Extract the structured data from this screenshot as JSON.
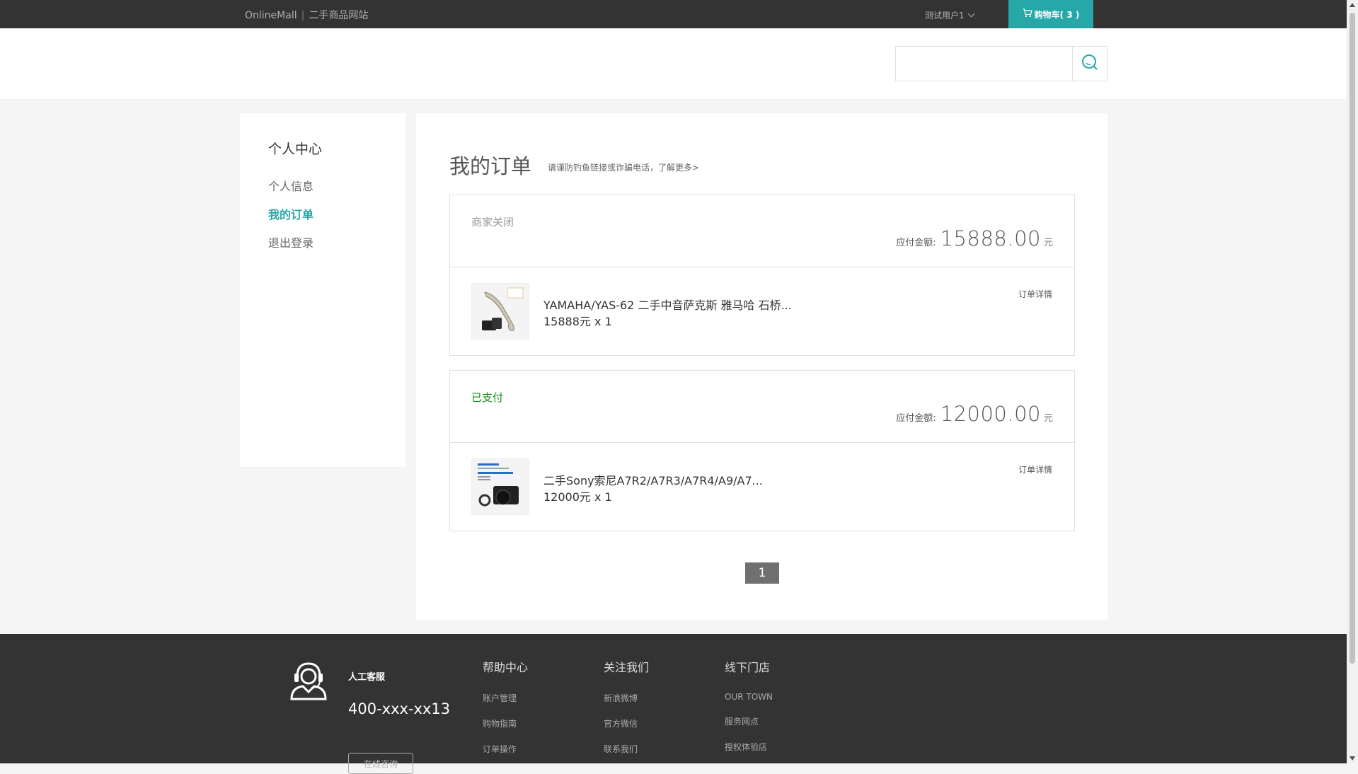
{
  "topbar": {
    "brand_name": "OnlineMall",
    "brand_separator": "|",
    "brand_subtitle": "二手商品网站",
    "username": "测试用户1",
    "cart_label": "购物车( 3 )",
    "cart_color": "#27a8a8"
  },
  "search": {
    "value": "",
    "button_icon": "search-icon"
  },
  "sidebar": {
    "title": "个人中心",
    "items": [
      {
        "label": "个人信息",
        "active": false
      },
      {
        "label": "我的订单",
        "active": true
      },
      {
        "label": "退出登录",
        "active": false
      }
    ]
  },
  "main": {
    "title": "我的订单",
    "tip": "请谨防钓鱼链接或诈骗电话，了解更多>",
    "amount_label": "应付金额:",
    "currency_unit": "元",
    "detail_label": "订单详情",
    "orders": [
      {
        "status": "商家关闭",
        "status_color": "#999999",
        "amount": "15888.00",
        "product_name": "YAMAHA/YAS-62 二手中音萨克斯 雅马哈 石桥...",
        "product_price": "15888元 x 1"
      },
      {
        "status": "已支付",
        "status_color": "#1a8f1a",
        "amount": "12000.00",
        "product_name": "二手Sony索尼A7R2/A7R3/A7R4/A9/A7...",
        "product_price": "12000元 x 1"
      }
    ],
    "pagination": {
      "current": "1"
    }
  },
  "footer": {
    "hotline_icon": "customer-service-headset-icon",
    "hotline_label": "人工客服",
    "hotline_number": "400-xxx-xx13",
    "consult_button": "在线咨询",
    "columns": [
      {
        "title": "帮助中心",
        "links": [
          "账户管理",
          "购物指南",
          "订单操作"
        ]
      },
      {
        "title": "关注我们",
        "links": [
          "新浪微博",
          "官方微信",
          "联系我们"
        ]
      },
      {
        "title": "线下门店",
        "links": [
          "OUR TOWN",
          "服务网点",
          "授权体验店"
        ]
      }
    ]
  }
}
